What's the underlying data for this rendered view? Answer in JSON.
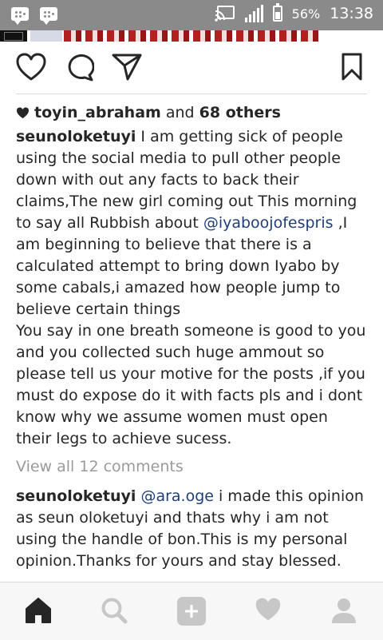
{
  "status_bar": {
    "battery_percent": "56%",
    "time": "13:38",
    "left_icons": [
      "bbm-icon",
      "bbm-icon"
    ],
    "right_icons": [
      "cast-icon",
      "signal-icon",
      "battery-icon"
    ]
  },
  "post": {
    "actions": [
      "heart-icon",
      "comment-icon",
      "share-icon",
      "bookmark-icon"
    ],
    "likes": {
      "user": "toyin_abraham",
      "connector": " and ",
      "others": "68 others"
    },
    "caption": {
      "username": "seunoloketuyi",
      "text_before_mention": " I am getting sick of people using the social media to pull other people down with out any facts to back their claims,The new girl coming out This morning to say all Rubbish about ",
      "mention": "@iyaboojofespris",
      "text_after_mention": " ,I am beginning to believe that there is a calculated attempt to bring down Iyabo by some cabals,i amazed how people jump to believe certain things",
      "paragraph2": "You say in one breath someone is good to you and you collected such huge ammout so please tell us your motive for the posts ,if you must do expose do it with facts pls and i dont know why we assume women must open their legs to achieve sucess."
    },
    "view_all_comments": "View all 12 comments",
    "comment": {
      "username": "seunoloketuyi",
      "mention": "@ara.oge",
      "text": " i made this opinion as seun oloketuyi and thats why i am not using the handle of bon.This is my personal opinion.Thanks for yours and stay blessed."
    }
  },
  "bottom_nav": {
    "items": [
      "home-icon",
      "search-icon",
      "add-post-icon",
      "activity-heart-icon",
      "profile-icon"
    ],
    "active": "home-icon"
  },
  "colors": {
    "status_bar": "#8a8a8a",
    "text": "#262626",
    "mention": "#1f3e77",
    "muted": "#9a9a9a",
    "nav_inactive": "#c7c7c7",
    "nav_active": "#262626"
  }
}
